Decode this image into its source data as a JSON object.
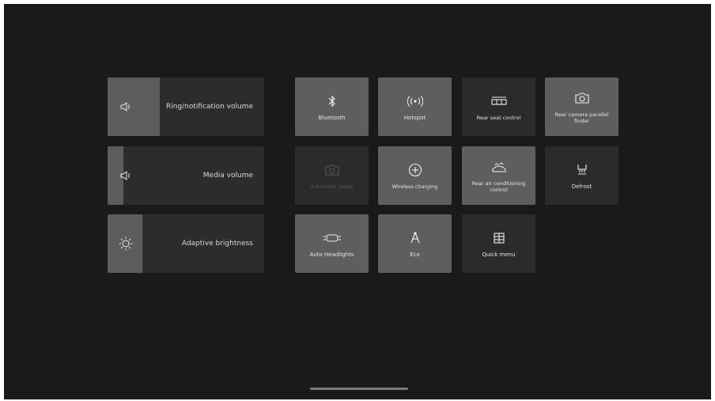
{
  "sliders": {
    "ringtone": {
      "label": "Ring/notification volume",
      "level": 0.33
    },
    "media": {
      "label": "Media volume",
      "level": 0.1
    },
    "brightness": {
      "label": "Adaptive brightness",
      "level": 0.22
    }
  },
  "tiles": [
    {
      "label": "Bluetooth",
      "icon": "bluetooth-icon",
      "state": "on"
    },
    {
      "label": "Hotspot",
      "icon": "hotspot-icon",
      "state": "on"
    },
    {
      "label": "Rear seat control",
      "icon": "rear-seat-icon",
      "state": "off"
    },
    {
      "label": "Rear camera parallel finder",
      "icon": "camera-icon",
      "state": "on"
    },
    {
      "label": "Automatic mode",
      "icon": "auto-mode-icon",
      "state": "dim"
    },
    {
      "label": "Wireless charging",
      "icon": "wireless-charging-icon",
      "state": "on"
    },
    {
      "label": "Rear air conditioning control",
      "icon": "air-conditioning-icon",
      "state": "on"
    },
    {
      "label": "Defrost",
      "icon": "defrost-icon",
      "state": "off"
    },
    {
      "label": "Auto Headlights",
      "icon": "headlight-icon",
      "state": "on"
    },
    {
      "label": "Eco",
      "icon": "eco-icon",
      "state": "on"
    },
    {
      "label": "Quick menu",
      "icon": "grid-icon",
      "state": "off"
    }
  ],
  "colors": {
    "background": "#1a1a1a",
    "tile_on": "#5e5e5e",
    "tile_off": "#2b2b2b",
    "slider_fill": "#5c5c5c"
  }
}
